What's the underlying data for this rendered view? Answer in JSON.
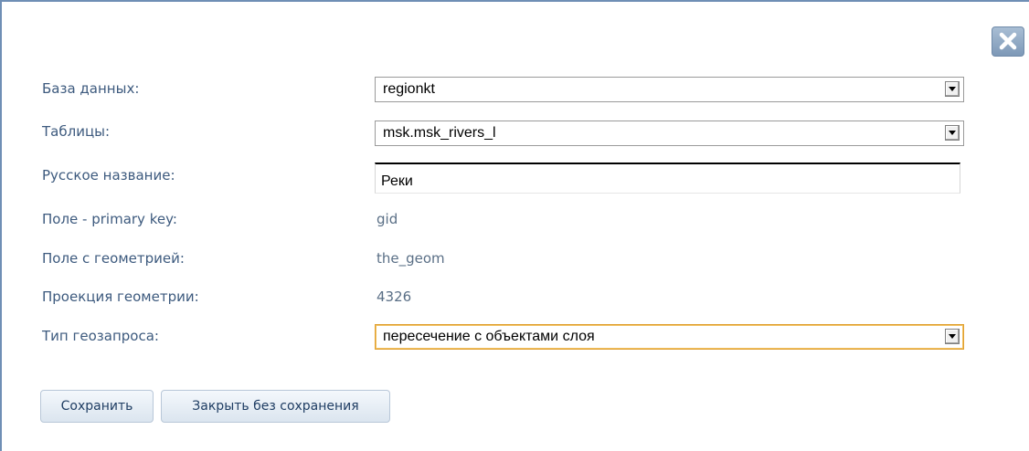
{
  "form": {
    "database_label": "База данных:",
    "database_value": "regionkt",
    "tables_label": "Таблицы:",
    "tables_value": "msk.msk_rivers_l",
    "russian_name_label": "Русское название:",
    "russian_name_value": "Реки",
    "primary_key_label": "Поле - primary key:",
    "primary_key_value": "gid",
    "geometry_field_label": "Поле с геометрией:",
    "geometry_field_value": "the_geom",
    "projection_label": "Проекция геометрии:",
    "projection_value": "4326",
    "geoquery_type_label": "Тип геозапроса:",
    "geoquery_type_value": "пересечение с объектами слоя"
  },
  "buttons": {
    "save_label": "Сохранить",
    "close_without_save_label": "Закрыть без сохранения"
  },
  "icons": {
    "close": "close-icon",
    "dropdown": "chevron-down-icon"
  },
  "colors": {
    "label_text": "#3d5a7e",
    "value_text": "#5a6f86",
    "focus_border": "#e0a030",
    "close_button": "#7d98b7"
  }
}
